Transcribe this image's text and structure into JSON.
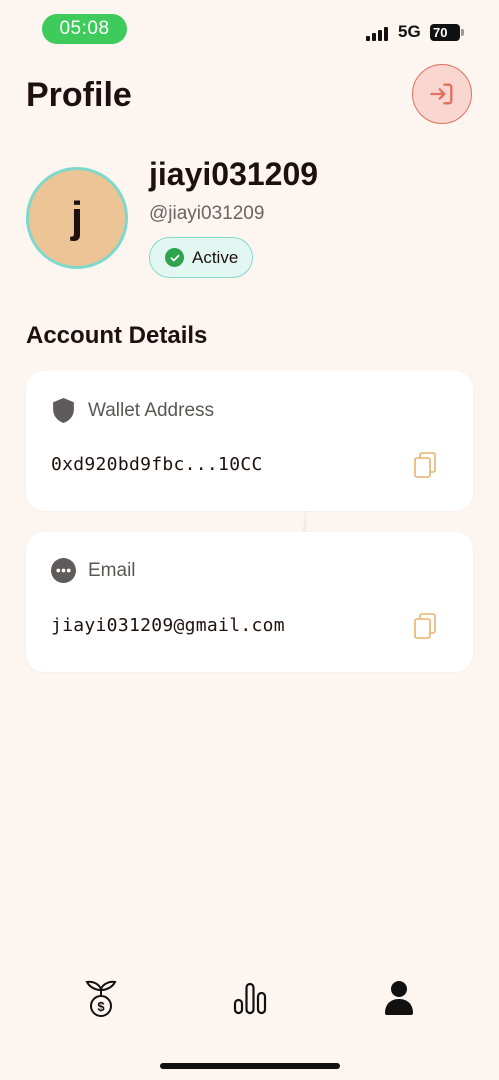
{
  "status_bar": {
    "time": "05:08",
    "network": "5G",
    "battery": "70"
  },
  "header": {
    "title": "Profile",
    "logout_icon": "logout-icon"
  },
  "profile": {
    "avatar_letter": "j",
    "username": "jiayi031209",
    "handle": "@jiayi031209",
    "status": "Active"
  },
  "account": {
    "title": "Account Details",
    "wallet": {
      "label": "Wallet Address",
      "value": "0xd920bd9fbc...10CC",
      "icon": "shield-icon"
    },
    "email": {
      "label": "Email",
      "value": "jiayi031209@gmail.com",
      "icon": "more-dots-icon"
    }
  },
  "tabs": [
    {
      "icon": "money-plant-icon",
      "active": false
    },
    {
      "icon": "bar-chart-icon",
      "active": false
    },
    {
      "icon": "profile-icon",
      "active": true
    }
  ],
  "colors": {
    "background": "#fdf5f0",
    "accent_red": "#e2705f",
    "active_green": "#2ea44f",
    "teal_border": "#7fd8cc",
    "avatar_fill": "#ecc495",
    "copy_icon": "#e8b36c"
  }
}
